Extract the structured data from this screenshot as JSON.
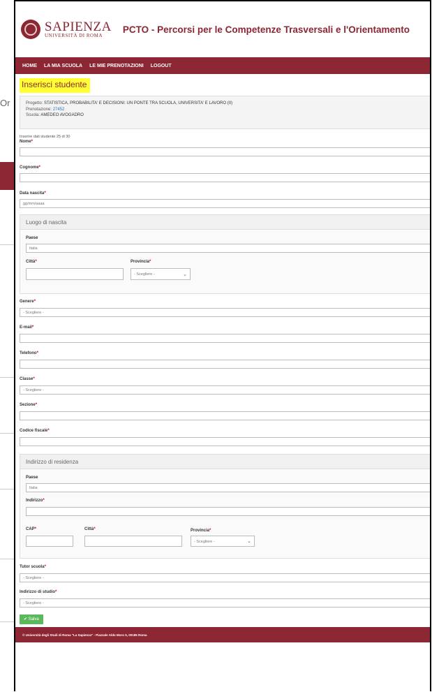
{
  "backdrop": {
    "cut_text": "Or"
  },
  "header": {
    "logo_main": "SAPIENZA",
    "logo_sub": "UNIVERSITÀ DI ROMA",
    "app_title": "PCTO - Percorsi per le Competenze Trasversali e l'Orientamento"
  },
  "nav": {
    "home": "HOME",
    "school": "LA MIA SCUOLA",
    "bookings": "LE MIE PRENOTAZIONI",
    "logout": "LOGOUT"
  },
  "page_title": "Inserisci studente",
  "project": {
    "project_label": "Progetto:",
    "project_value": "STATISTICA, PROBABILITA' E DECISIONI: UN PONTE TRA SCUOLA, UNIVERSITA' E LAVORO (II)",
    "booking_label": "Prenotazione:",
    "booking_value": "27452",
    "school_label": "Scuola:",
    "school_value": "AMEDEO AVOGADRO"
  },
  "form": {
    "counter_note": "Inserire dati studente 25 di 30",
    "nome": "Nome",
    "cognome": "Cognome",
    "data_nascita": "Data nascita",
    "data_placeholder": "gg/mm/aaaa",
    "luogo_title": "Luogo di nascita",
    "paese": "Paese",
    "paese_value": "Italia",
    "citta": "Città",
    "provincia": "Provincia",
    "select_default": "- Scegliere -",
    "genere": "Genere",
    "email": "E-mail",
    "telefono": "Telefono",
    "classe": "Classe",
    "sezione": "Sezione",
    "codice_fiscale": "Codice fiscale",
    "residenza_title": "Indirizzo di residenza",
    "paese_res": "Paese",
    "paese_res_value": "Italia",
    "indirizzo": "Indirizzo",
    "cap": "CAP",
    "citta_res": "Città",
    "provincia_res": "Provincia",
    "tutor": "Tutor scuola",
    "indirizzo_studio": "Indirizzo di studio",
    "save": "Salva",
    "required_mark": "*",
    "caret": "❯",
    "check": "✔"
  },
  "footer": {
    "text": "© Università degli Studi di Roma \"La Sapienza\" - Piazzale Aldo Moro 5, 00185 Roma"
  }
}
